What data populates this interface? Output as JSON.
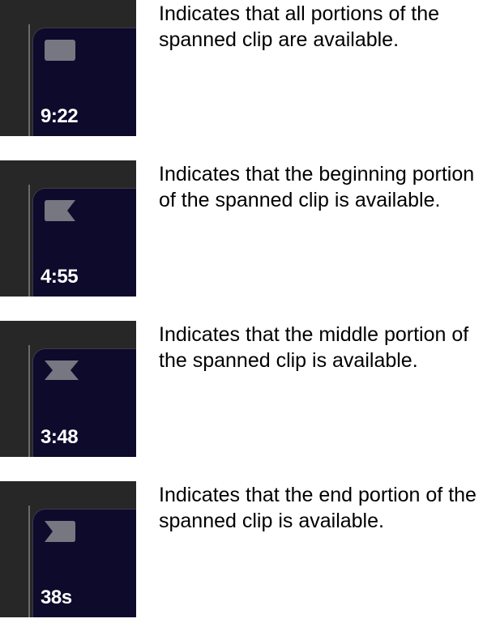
{
  "rows": [
    {
      "marker": "all",
      "timestamp": "9:22",
      "description": "Indicates that all portions of the spanned clip are available."
    },
    {
      "marker": "beginning",
      "timestamp": "4:55",
      "description": "Indicates that the beginning portion of the spanned clip is available."
    },
    {
      "marker": "middle",
      "timestamp": "3:48",
      "description": "Indicates that the middle portion of the spanned clip is available."
    },
    {
      "marker": "end",
      "timestamp": "38s",
      "description": "Indicates that the end portion of the spanned clip is available."
    }
  ],
  "colors": {
    "markerFill": "#777781",
    "bg": "#272727",
    "clip": "#0d0a2c"
  }
}
